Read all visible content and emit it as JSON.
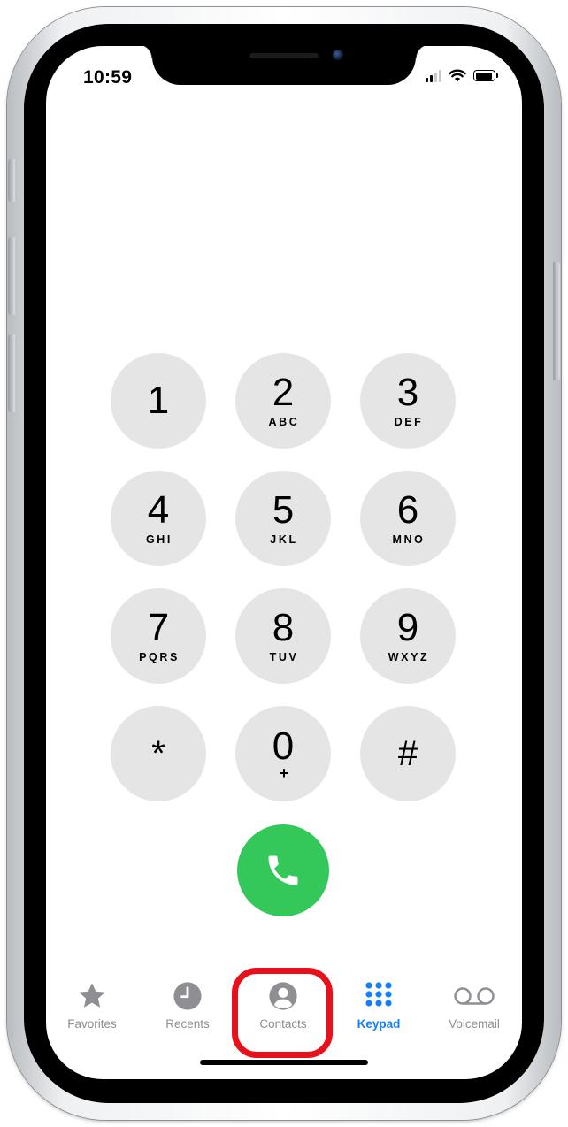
{
  "status_bar": {
    "time": "10:59",
    "icons": [
      "cellular-signal-icon",
      "wifi-icon",
      "battery-icon"
    ]
  },
  "keypad": {
    "keys": [
      {
        "digit": "1",
        "letters": ""
      },
      {
        "digit": "2",
        "letters": "ABC"
      },
      {
        "digit": "3",
        "letters": "DEF"
      },
      {
        "digit": "4",
        "letters": "GHI"
      },
      {
        "digit": "5",
        "letters": "JKL"
      },
      {
        "digit": "6",
        "letters": "MNO"
      },
      {
        "digit": "7",
        "letters": "PQRS"
      },
      {
        "digit": "8",
        "letters": "TUV"
      },
      {
        "digit": "9",
        "letters": "WXYZ"
      },
      {
        "digit": "*",
        "letters": ""
      },
      {
        "digit": "0",
        "letters": "+"
      },
      {
        "digit": "#",
        "letters": ""
      }
    ],
    "key_color": "#e5e5e5"
  },
  "call": {
    "icon": "phone-icon",
    "color": "#34c759"
  },
  "tab_bar": {
    "tabs": [
      {
        "label": "Favorites",
        "icon": "star-icon",
        "active": false
      },
      {
        "label": "Recents",
        "icon": "clock-icon",
        "active": false
      },
      {
        "label": "Contacts",
        "icon": "person-circle-icon",
        "active": false
      },
      {
        "label": "Keypad",
        "icon": "keypad-grid-icon",
        "active": true
      },
      {
        "label": "Voicemail",
        "icon": "voicemail-icon",
        "active": false
      }
    ],
    "active_color": "#147efb",
    "inactive_color": "#8e8e93"
  },
  "annotation": {
    "highlight_color": "#e8101a",
    "highlighted_tab": "Contacts"
  }
}
